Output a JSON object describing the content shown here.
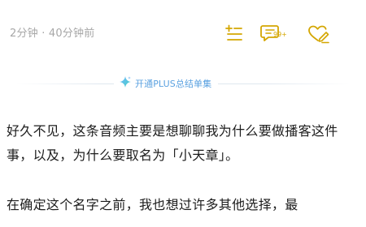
{
  "meta": {
    "text": "2分钟 · 40分钟前"
  },
  "actions": {
    "comments_badge": "99+"
  },
  "summary": {
    "label": "开通PLUS总结单集"
  },
  "article": {
    "paragraphs": [
      "好久不见，这条音频主要是想聊聊我为什么要做播客这件事，以及，为什么要取名为「小天章」。",
      "在确定这个名字之前，我也想过许多其他选择，最"
    ]
  },
  "colors": {
    "accent": "#d4a600",
    "link": "#5aa1e0",
    "text": "#1c1c1c",
    "meta": "#a7a7a7"
  },
  "icons": [
    "playlist-add-icon",
    "comment-icon",
    "heart-edit-icon",
    "sparkle-icon"
  ]
}
